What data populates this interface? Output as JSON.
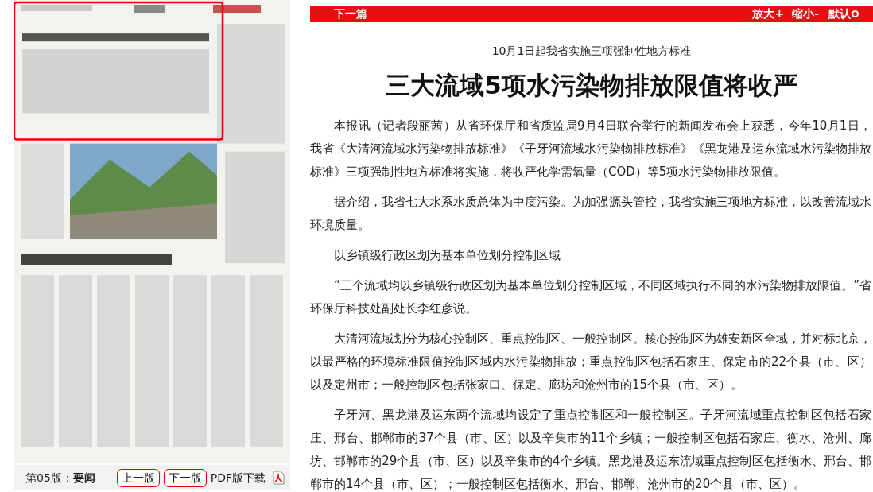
{
  "toolbar": {
    "next_article": "下一篇",
    "zoom_in": "放大+",
    "zoom_out": "缩小-",
    "reset": "默认"
  },
  "page_nav": {
    "edition_label": "第05版：",
    "edition_name": "要闻",
    "prev": "上一版",
    "next": "下一版",
    "pdf": "PDF版下载"
  },
  "article": {
    "subtitle": "10月1日起我省实施三项强制性地方标准",
    "title": "三大流域5项水污染物排放限值将收严",
    "paragraphs": [
      "本报讯（记者段丽茜）从省环保厅和省质监局9月4日联合举行的新闻发布会上获悉，今年10月1日，我省《大清河流域水污染物排放标准》《子牙河流域水污染物排放标准》《黑龙港及运东流域水污染物排放标准》三项强制性地方标准将实施，将收严化学需氧量（COD）等5项水污染物排放限值。",
      "据介绍，我省七大水系水质总体为中度污染。为加强源头管控，我省实施三项地方标准，以改善流域水环境质量。",
      "以乡镇级行政区划为基本单位划分控制区域",
      "“三个流域均以乡镇级行政区划为基本单位划分控制区域，不同区域执行不同的水污染物排放限值。”省环保厅科技处副处长李红彦说。",
      "大清河流域划分为核心控制区、重点控制区、一般控制区。核心控制区为雄安新区全域，并对标北京，以最严格的环境标准限值控制区域内水污染物排放；重点控制区包括石家庄、保定市的22个县（市、区）以及定州市；一般控制区包括张家口、保定、廊坊和沧州市的15个县（市、区）。",
      "子牙河、黑龙港及运东两个流域均设定了重点控制区和一般控制区。子牙河流域重点控制区包括石家庄、邢台、邯郸市的37个县（市、区）以及辛集市的11个乡镇；一般控制区包括石家庄、衡水、沧州、廊坊、邯郸市的29个县（市、区）以及辛集市的4个乡镇。黑龙港及运东流域重点控制区包括衡水、邢台、邯郸市的14个县（市、区）；一般控制区包括衡水、邢台、邯郸、沧州市的20个县（市、区）。"
    ]
  }
}
